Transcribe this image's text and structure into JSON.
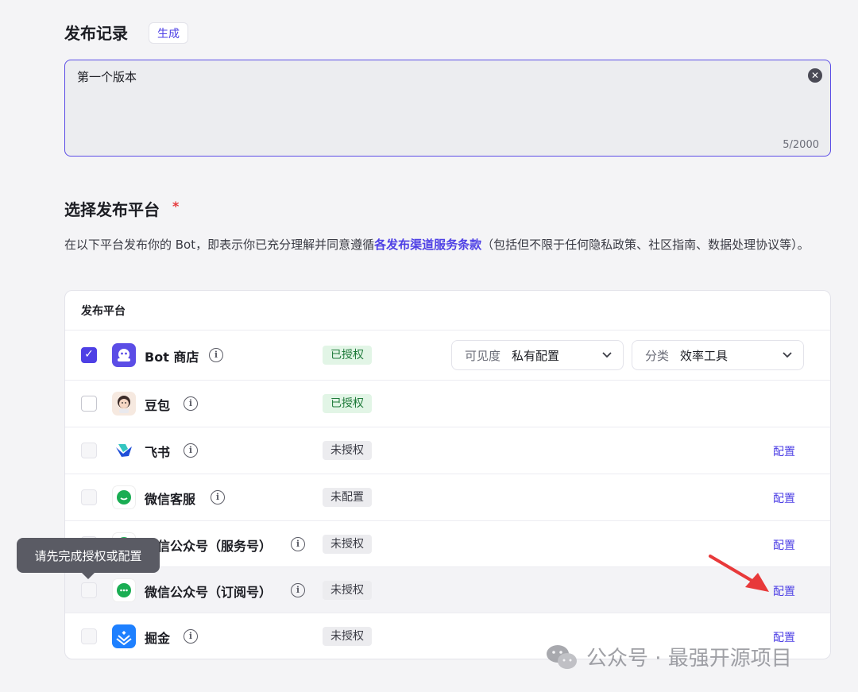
{
  "record": {
    "title": "发布记录",
    "generate_label": "生成",
    "text": "第一个版本",
    "counter": "5/2000"
  },
  "platform": {
    "title": "选择发布平台",
    "required_mark": "*",
    "terms_before": "在以下平台发布你的 Bot，即表示你已充分理解并同意遵循",
    "terms_link": "各发布渠道服务条款",
    "terms_after": "（包括但不限于任何隐私政策、社区指南、数据处理协议等）。",
    "table_header": "发布平台",
    "rows": [
      {
        "name": "Bot 商店",
        "status": "已授权",
        "checked": true
      },
      {
        "name": "豆包",
        "status": "已授权",
        "checked": false
      },
      {
        "name": "飞书",
        "status": "未授权",
        "config": "配置"
      },
      {
        "name": "微信客服",
        "status": "未配置",
        "config": "配置"
      },
      {
        "name": "微信公众号（服务号）",
        "status": "未授权",
        "config": "配置"
      },
      {
        "name": "微信公众号（订阅号）",
        "status": "未授权",
        "config": "配置"
      },
      {
        "name": "掘金",
        "status": "未授权",
        "config": "配置"
      }
    ],
    "visibility": {
      "label": "可见度",
      "value": "私有配置"
    },
    "category": {
      "label": "分类",
      "value": "效率工具"
    }
  },
  "tooltip": "请先完成授权或配置",
  "watermark": "公众号 · 最强开源项目",
  "colors": {
    "accent": "#4e40e5",
    "arrow": "#e8393a",
    "wechat": "#1aad53"
  }
}
